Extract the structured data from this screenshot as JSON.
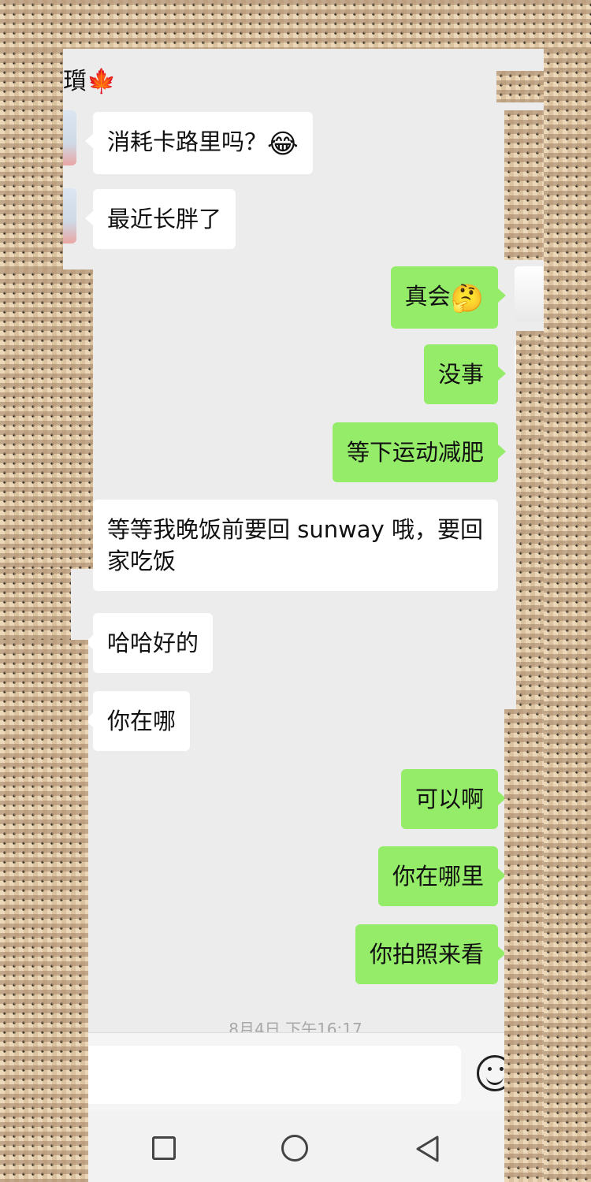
{
  "header": {
    "title_fragment": "瓆",
    "title_emoji": "🍁"
  },
  "messages": [
    {
      "side": "in",
      "text": "消耗卡路里吗？",
      "emoji": "😂"
    },
    {
      "side": "in",
      "text": "最近长胖了"
    },
    {
      "side": "out",
      "text": "真会",
      "emoji": "🤔"
    },
    {
      "side": "out",
      "text": "没事"
    },
    {
      "side": "out",
      "text": "等下运动减肥"
    },
    {
      "side": "in",
      "text": "等等我晚饭前要回 sunway 哦，要回家吃饭"
    },
    {
      "side": "in",
      "text": "哈哈好的"
    },
    {
      "side": "in",
      "text": "你在哪"
    },
    {
      "side": "out",
      "text": "可以啊"
    },
    {
      "side": "out",
      "text": "你在哪里"
    },
    {
      "side": "out",
      "text": "你拍照来看"
    }
  ],
  "timestamp": "8月4日 下午16:17",
  "input": {
    "emoji_button_icon": "smiley-icon"
  },
  "navbar": {
    "icons": [
      "recent-apps-icon",
      "home-icon",
      "back-icon"
    ]
  }
}
